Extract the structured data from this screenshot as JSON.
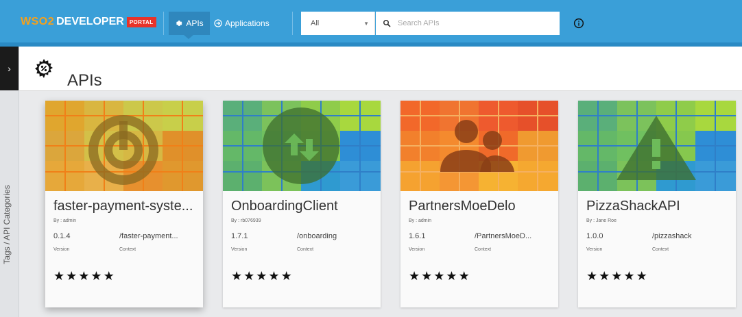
{
  "header": {
    "logo": {
      "brand": "WSO2",
      "product": "DEVELOPER",
      "badge": "PORTAL"
    },
    "nav": [
      {
        "label": "APIs",
        "icon": "gear-icon",
        "active": true
      },
      {
        "label": "Applications",
        "icon": "applications-icon",
        "active": false
      }
    ],
    "filter": {
      "selected": "All"
    },
    "search": {
      "placeholder": "Search APIs",
      "value": ""
    },
    "info_icon": "info-icon"
  },
  "sidebar": {
    "label": "Tags / API Categories",
    "toggle_icon": "chevron-right-icon"
  },
  "page": {
    "title": "APIs",
    "icon": "gear-icon"
  },
  "cards": [
    {
      "name": "faster-payment-syste...",
      "author": "By : admin",
      "version": "0.1.4",
      "context": "/faster-payment...",
      "version_label": "Version",
      "context_label": "Context",
      "rating_stars": 5,
      "icon": "power-icon"
    },
    {
      "name": "OnboardingClient",
      "author": "By : rb076939",
      "version": "1.7.1",
      "context": "/onboarding",
      "version_label": "Version",
      "context_label": "Context",
      "rating_stars": 5,
      "icon": "upload-download-icon"
    },
    {
      "name": "PartnersMoeDelo",
      "author": "By : admin",
      "version": "1.6.1",
      "context": "/PartnersMoeD...",
      "version_label": "Version",
      "context_label": "Context",
      "rating_stars": 5,
      "icon": "people-icon"
    },
    {
      "name": "PizzaShackAPI",
      "author": "By : Jane Roe",
      "version": "1.0.0",
      "context": "/pizzashack",
      "version_label": "Version",
      "context_label": "Context",
      "rating_stars": 5,
      "icon": "warning-icon"
    }
  ],
  "colors": {
    "header": "#3a9fd8",
    "portal_badge": "#e8332a",
    "logo_orange": "#f7a11a"
  }
}
